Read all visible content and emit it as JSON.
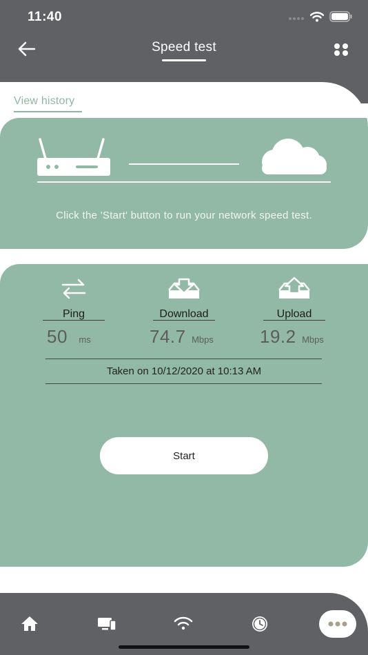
{
  "status": {
    "time": "11:40"
  },
  "header": {
    "title": "Speed test"
  },
  "history_link": "View history",
  "network_card": {
    "instruction": "Click the 'Start' button to run your network speed test."
  },
  "metrics": [
    {
      "label": "Ping",
      "value": "50",
      "unit": "ms",
      "icon": "transfer-arrows-icon"
    },
    {
      "label": "Download",
      "value": "74.7",
      "unit": "Mbps",
      "icon": "download-tray-icon"
    },
    {
      "label": "Upload",
      "value": "19.2",
      "unit": "Mbps",
      "icon": "upload-tray-icon"
    }
  ],
  "last_test": "Taken on 10/12/2020 at 10:13 AM",
  "start_label": "Start",
  "tabbar": {
    "tabs": [
      "home-icon",
      "devices-icon",
      "wifi-icon",
      "clock-icon",
      "more-icon"
    ],
    "selected": "more"
  },
  "colors": {
    "header": "#606164",
    "card": "#91b9a5",
    "accent": "#8fb7a4"
  }
}
